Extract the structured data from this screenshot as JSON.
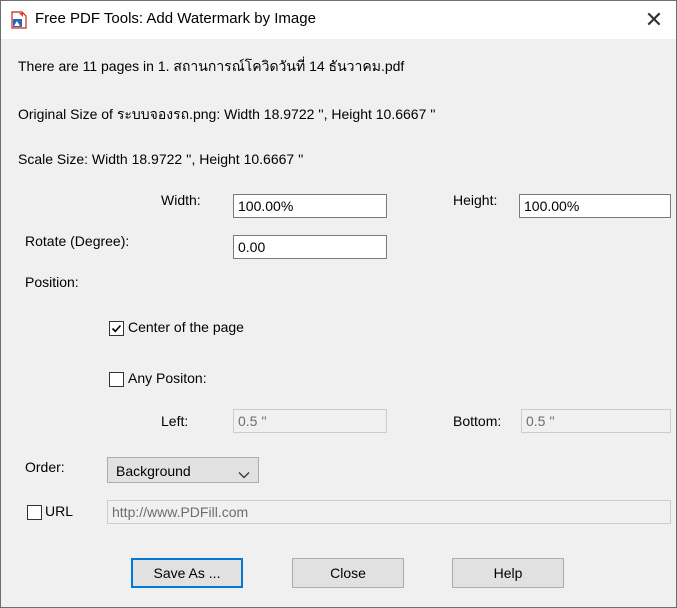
{
  "window": {
    "title": "Free PDF Tools: Add Watermark by Image",
    "close_symbol": "✕"
  },
  "info": {
    "pages_line": "There are 11 pages in 1. สถานการณ์โควิดวันที่ 14 ธันวาคม.pdf",
    "original_size_line": "Original Size of ระบบจองรถ.png:  Width 18.9722 '',   Height 10.6667 ''",
    "scale_size_line": "Scale Size:  Width 18.9722 '',   Height 10.6667 ''"
  },
  "scale": {
    "width_label": "Width:",
    "width_value": "100.00%",
    "height_label": "Height:",
    "height_value": "100.00%"
  },
  "rotate": {
    "label": "Rotate (Degree):",
    "value": "0.00"
  },
  "position": {
    "label": "Position:",
    "center_label": "Center of the page",
    "center_checked": true,
    "any_label": "Any Positon:",
    "any_checked": false,
    "left_label": "Left:",
    "left_value": "0.5 ''",
    "bottom_label": "Bottom:",
    "bottom_value": "0.5 ''"
  },
  "order": {
    "label": "Order:",
    "selected": "Background"
  },
  "url": {
    "label": "URL",
    "checked": false,
    "value": "http://www.PDFill.com"
  },
  "buttons": {
    "save_as": "Save As ...",
    "close": "Close",
    "help": "Help"
  },
  "colors": {
    "accent": "#0078d7",
    "dialog_bg": "#f0f0f0",
    "button_bg": "#e1e1e1"
  }
}
